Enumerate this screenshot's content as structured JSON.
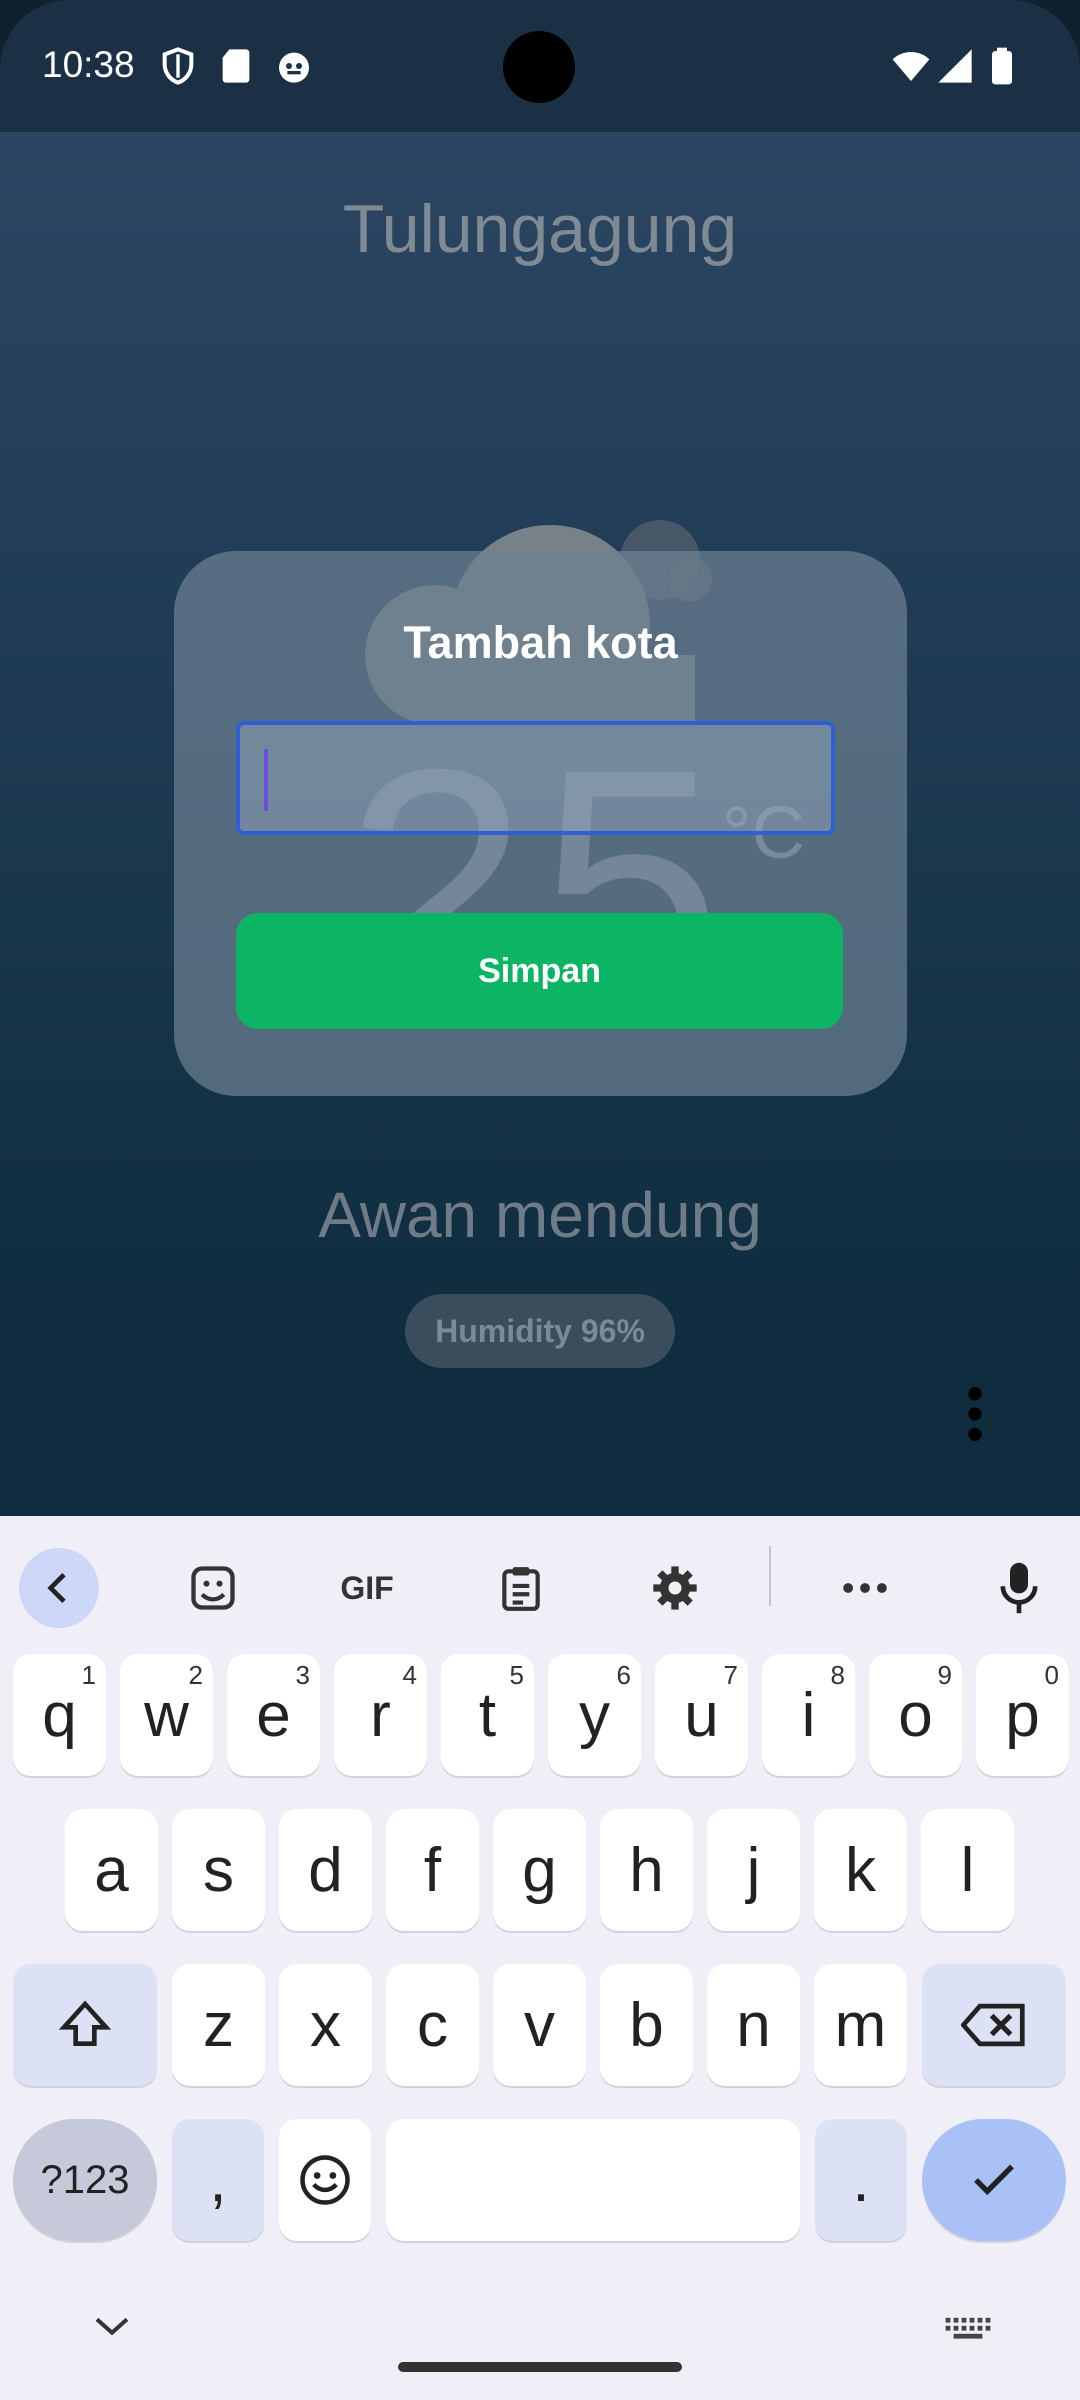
{
  "status_bar": {
    "time": "10:38"
  },
  "weather": {
    "city": "Tulungagung",
    "temperature": "25",
    "unit": "°C",
    "condition": "Awan mendung",
    "humidity": "Humidity 96%"
  },
  "dialog": {
    "title": "Tambah kota",
    "input_value": "",
    "save_label": "Simpan"
  },
  "keyboard": {
    "toolbar": [
      "back-icon",
      "sticker-icon",
      "GIF",
      "clipboard-icon",
      "settings-icon",
      "more-icon",
      "mic-icon"
    ],
    "gif_label": "GIF",
    "row1": [
      {
        "k": "q",
        "h": "1"
      },
      {
        "k": "w",
        "h": "2"
      },
      {
        "k": "e",
        "h": "3"
      },
      {
        "k": "r",
        "h": "4"
      },
      {
        "k": "t",
        "h": "5"
      },
      {
        "k": "y",
        "h": "6"
      },
      {
        "k": "u",
        "h": "7"
      },
      {
        "k": "i",
        "h": "8"
      },
      {
        "k": "o",
        "h": "9"
      },
      {
        "k": "p",
        "h": "0"
      }
    ],
    "row2": [
      "a",
      "s",
      "d",
      "f",
      "g",
      "h",
      "j",
      "k",
      "l"
    ],
    "row3": [
      "z",
      "x",
      "c",
      "v",
      "b",
      "n",
      "m"
    ],
    "symbols_label": "?123",
    "comma": ",",
    "period": "."
  },
  "colors": {
    "accent_green": "#0cb563",
    "input_border": "#2f5fd7",
    "keyboard_bg": "#f0eff7"
  }
}
